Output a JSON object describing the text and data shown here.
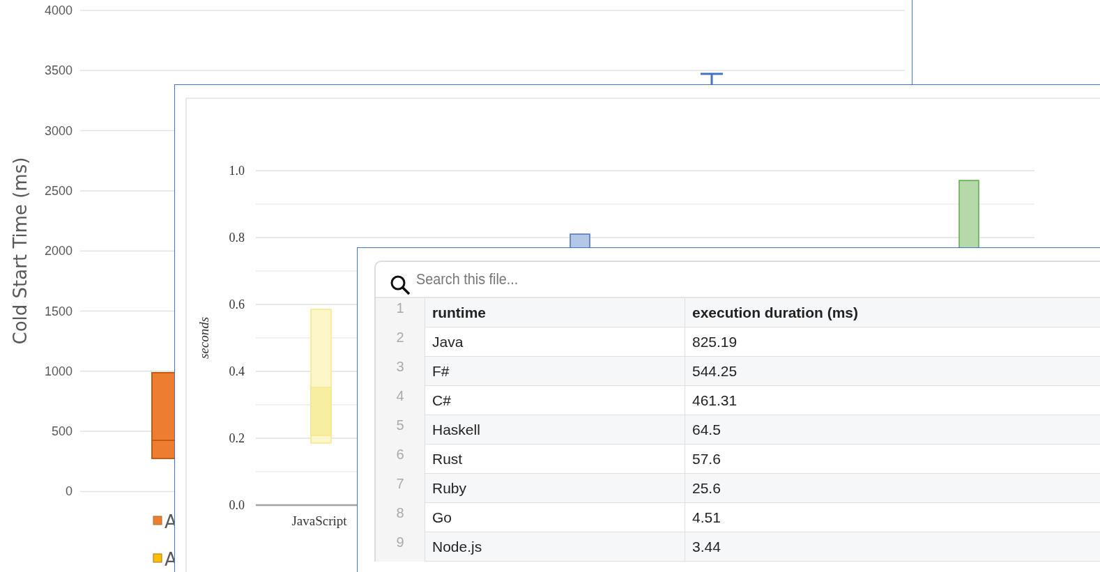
{
  "cold_start_chart": {
    "ylabel": "Cold Start Time (ms)",
    "yticks": [
      "4000",
      "3500",
      "3000",
      "2500",
      "2000",
      "1500",
      "1000",
      "500",
      "0"
    ],
    "legend": [
      {
        "label": "A",
        "color": "#ed7d31"
      },
      {
        "label": "A",
        "color": "#ffc000"
      }
    ]
  },
  "duration_chart": {
    "ylabel": "seconds",
    "yticks": [
      "1.0",
      "0.8",
      "0.6",
      "0.4",
      "0.2",
      "0.0"
    ],
    "categories": [
      "JavaScript"
    ]
  },
  "file_viewer": {
    "search": {
      "placeholder": "Search this file..."
    },
    "columns": [
      {
        "line": "1",
        "cells": [
          "runtime",
          "execution duration (ms)"
        ]
      }
    ],
    "rows": [
      {
        "line": "2",
        "cells": [
          "Java",
          "825.19"
        ]
      },
      {
        "line": "3",
        "cells": [
          "F#",
          "544.25"
        ]
      },
      {
        "line": "4",
        "cells": [
          "C#",
          "461.31"
        ]
      },
      {
        "line": "5",
        "cells": [
          "Haskell",
          "64.5"
        ]
      },
      {
        "line": "6",
        "cells": [
          "Rust",
          "57.6"
        ]
      },
      {
        "line": "7",
        "cells": [
          "Ruby",
          "25.6"
        ]
      },
      {
        "line": "8",
        "cells": [
          "Go",
          "4.51"
        ]
      },
      {
        "line": "9",
        "cells": [
          "Node.js",
          "3.44"
        ]
      }
    ]
  }
}
